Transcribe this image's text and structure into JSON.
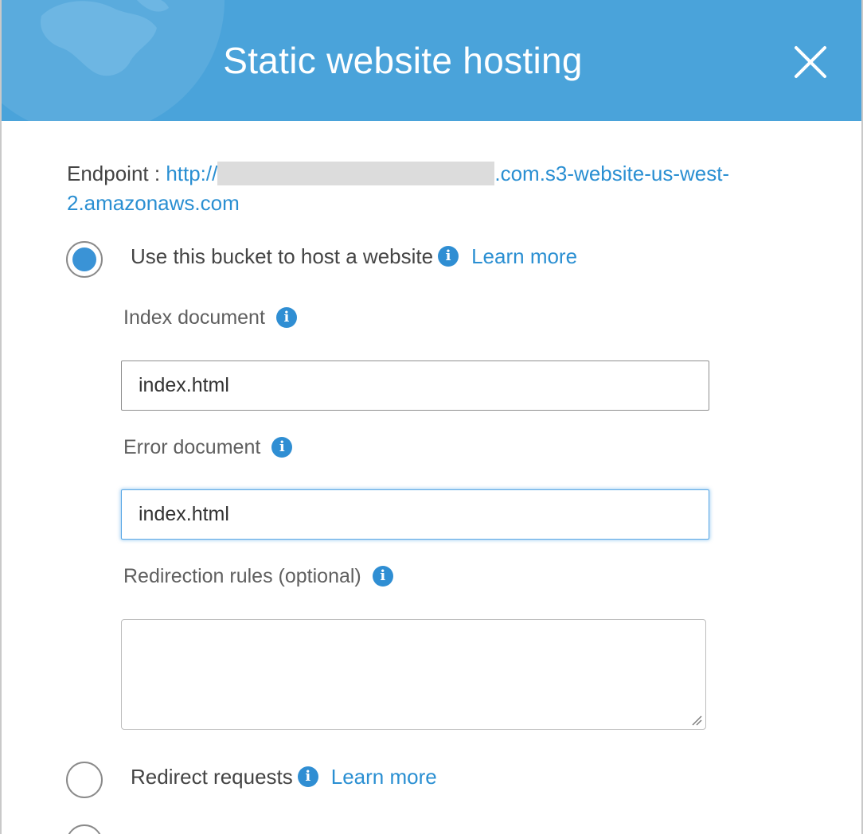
{
  "dialog": {
    "title": "Static website hosting",
    "close_icon": "close-icon",
    "header_color": "#4aa3da"
  },
  "endpoint": {
    "label": "Endpoint : ",
    "url_prefix": "http://",
    "url_suffix": ".com.s3-website-us-west-2.amazonaws.com"
  },
  "options": [
    {
      "label": "Use this bucket to host a website",
      "learn_more": "Learn more",
      "checked": true
    },
    {
      "label": "Redirect requests",
      "learn_more": "Learn more",
      "checked": false
    }
  ],
  "fields": {
    "index_document": {
      "label": "Index document",
      "value": "index.html"
    },
    "error_document": {
      "label": "Error document",
      "value": "index.html"
    },
    "redirection_rules": {
      "label": "Redirection rules (optional)",
      "value": ""
    }
  },
  "colors": {
    "accent": "#2a8fd2",
    "radio_fill": "#3a93d6"
  }
}
